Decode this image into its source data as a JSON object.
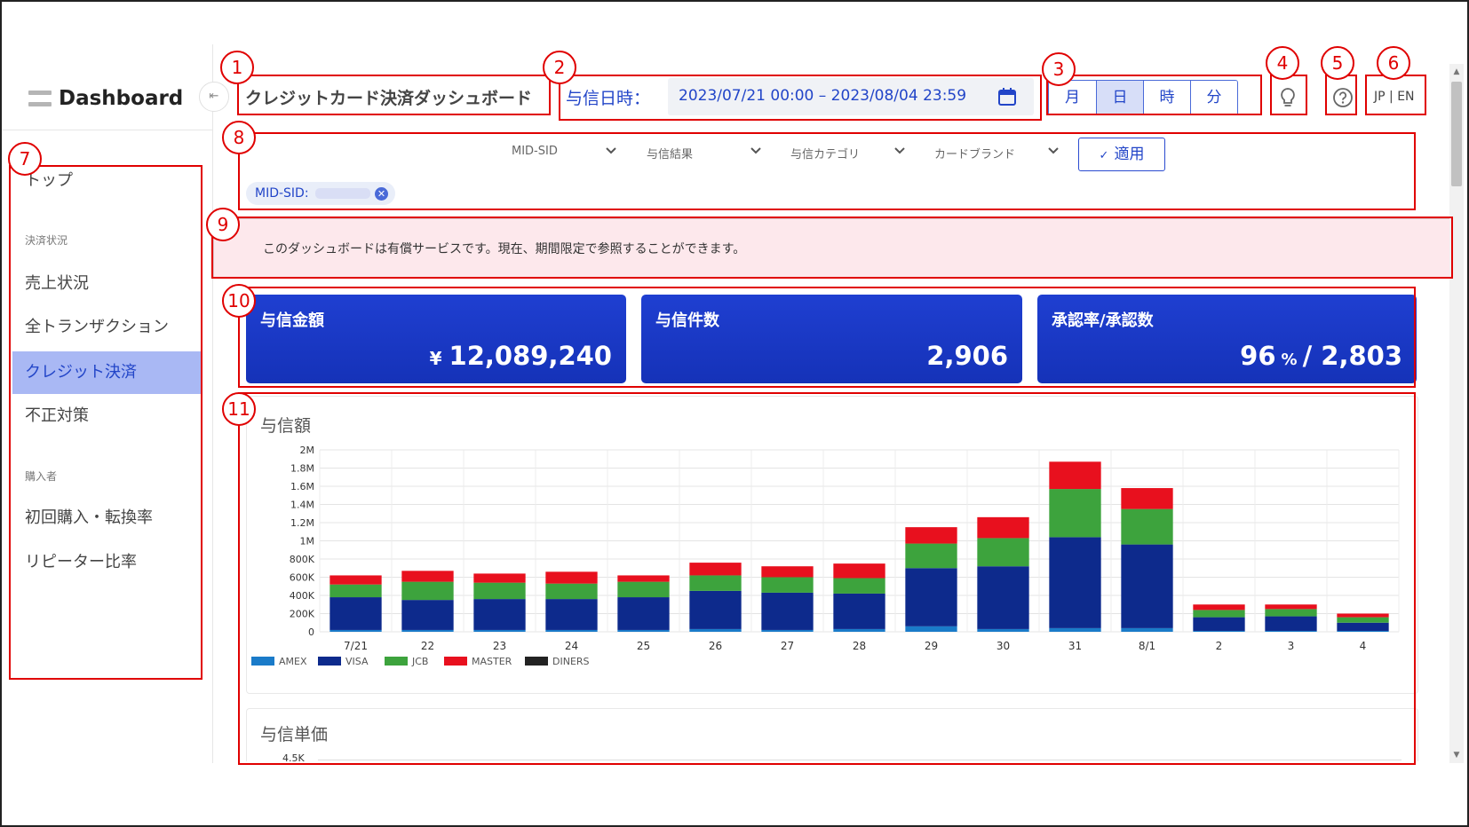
{
  "sidebar": {
    "logo": "Dashboard",
    "items": [
      {
        "label": "トップ"
      },
      {
        "label": "売上状況"
      },
      {
        "label": "全トランザクション"
      },
      {
        "label": "クレジット決済"
      },
      {
        "label": "不正対策"
      },
      {
        "label": "初回購入・転換率"
      },
      {
        "label": "リピーター比率"
      }
    ],
    "sections": [
      "決済状況",
      "購入者"
    ],
    "collapse_icon": "collapse-left-icon"
  },
  "header": {
    "title": "クレジットカード決済ダッシュボード",
    "date_label": "与信日時：",
    "date_range": "2023/07/21 00:00 – 2023/08/04 23:59",
    "granularity": [
      "月",
      "日",
      "時",
      "分"
    ],
    "granularity_selected": "日",
    "lang": "JP | EN"
  },
  "filters": {
    "dropdowns": [
      "MID-SID",
      "与信結果",
      "与信カテゴリ",
      "カードブランド"
    ],
    "apply_label": "適用",
    "chip_label": "MID-SID:"
  },
  "notice": "このダッシュボードは有償サービスです。現在、期間限定で参照することができます。",
  "kpis": [
    {
      "label": "与信金額",
      "prefix": "¥",
      "value": "12,089,240"
    },
    {
      "label": "与信件数",
      "value": "2,906"
    },
    {
      "label": "承認率/承認数",
      "rate": "96",
      "rate_unit": "%",
      "sep": "/",
      "count": "2,803"
    }
  ],
  "annotations": [
    "1",
    "2",
    "3",
    "4",
    "5",
    "6",
    "7",
    "8",
    "9",
    "10",
    "11"
  ],
  "colors": {
    "accent": "#2245c8",
    "kpi_bg": "#1a38c4",
    "notice_bg": "#fde8ec",
    "annotation": "#e00000"
  },
  "chart_data": {
    "type": "bar",
    "title": "与信額",
    "stacked": true,
    "categories": [
      "7/21",
      "22",
      "23",
      "24",
      "25",
      "26",
      "27",
      "28",
      "29",
      "30",
      "31",
      "8/1",
      "2",
      "3",
      "4"
    ],
    "y_ticks": [
      "0",
      "200K",
      "400K",
      "600K",
      "800K",
      "1M",
      "1.2M",
      "1.4M",
      "1.6M",
      "1.8M",
      "2M"
    ],
    "ylim": [
      0,
      2000000
    ],
    "legend_position": "bottom-left",
    "grid": true,
    "series": [
      {
        "name": "AMEX",
        "color": "#1a7bc9",
        "values": [
          20000,
          20000,
          20000,
          20000,
          20000,
          30000,
          20000,
          30000,
          60000,
          30000,
          40000,
          40000,
          10000,
          10000,
          10000
        ]
      },
      {
        "name": "VISA",
        "color": "#0d2a8c",
        "values": [
          360000,
          330000,
          340000,
          340000,
          360000,
          420000,
          410000,
          390000,
          640000,
          690000,
          1000000,
          920000,
          150000,
          160000,
          90000
        ]
      },
      {
        "name": "JCB",
        "color": "#3da33d",
        "values": [
          140000,
          200000,
          180000,
          170000,
          170000,
          170000,
          170000,
          170000,
          270000,
          310000,
          530000,
          390000,
          80000,
          80000,
          60000
        ]
      },
      {
        "name": "MASTER",
        "color": "#e8101e",
        "values": [
          100000,
          120000,
          100000,
          130000,
          70000,
          140000,
          120000,
          160000,
          180000,
          230000,
          300000,
          230000,
          60000,
          50000,
          40000
        ]
      },
      {
        "name": "DINERS",
        "color": "#222222",
        "values": [
          0,
          0,
          0,
          0,
          0,
          0,
          0,
          0,
          0,
          0,
          0,
          0,
          0,
          0,
          0
        ]
      }
    ]
  },
  "chart2": {
    "title": "与信単価",
    "top_tick": "4.5K"
  }
}
